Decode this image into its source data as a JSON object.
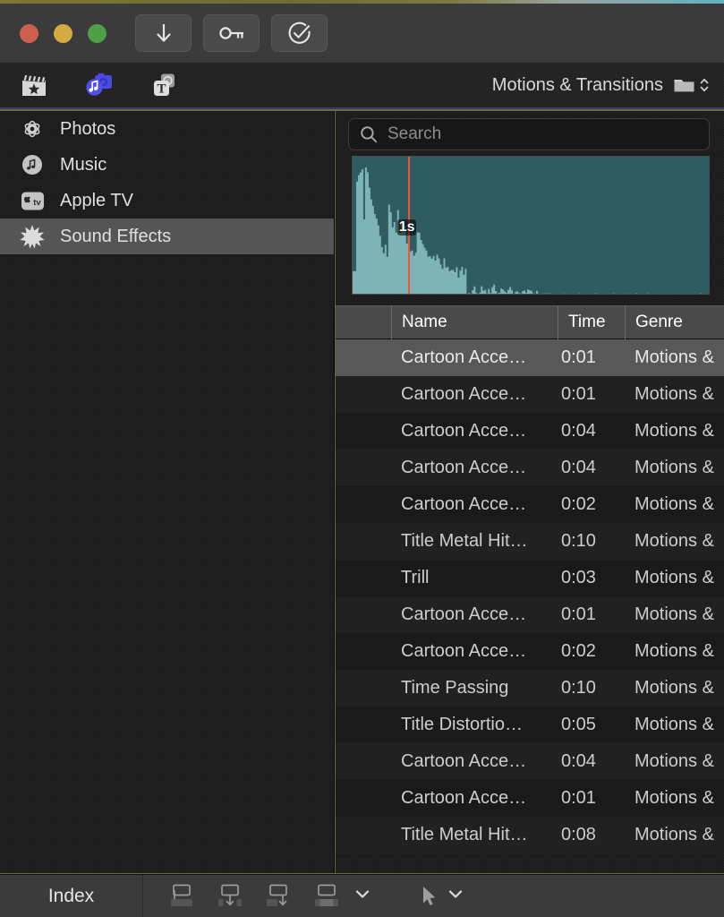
{
  "window": {
    "traffic_lights": [
      {
        "name": "close-button",
        "color": "#cc5f4f"
      },
      {
        "name": "minimize-button",
        "color": "#d5ab3f"
      },
      {
        "name": "zoom-button",
        "color": "#4f9e48"
      }
    ],
    "toolbar_buttons": [
      {
        "name": "download-button",
        "icon": "download-arrow-icon"
      },
      {
        "name": "keyword-button",
        "icon": "key-icon"
      },
      {
        "name": "share-approve-button",
        "icon": "checkmark-circle-icon"
      }
    ]
  },
  "browser_header": {
    "tabs": [
      {
        "name": "tab-libraries",
        "icon": "clapperboard-star-icon",
        "active": false
      },
      {
        "name": "tab-photos-audio",
        "icon": "photos-audio-icon",
        "active": true
      },
      {
        "name": "tab-titles-generators",
        "icon": "titles-generators-icon",
        "active": false
      }
    ],
    "title": "Motions & Transitions",
    "folder_icon": "folder-icon",
    "popup_icon": "chevron-up-down-icon"
  },
  "sidebar": {
    "items": [
      {
        "label": "Photos",
        "icon": "photos-flower-icon",
        "selected": false
      },
      {
        "label": "Music",
        "icon": "music-note-icon",
        "selected": false
      },
      {
        "label": "Apple TV",
        "icon": "apple-tv-icon",
        "selected": false
      },
      {
        "label": "Sound Effects",
        "icon": "sound-effects-star-icon",
        "selected": true
      }
    ]
  },
  "search": {
    "placeholder": "Search",
    "value": "",
    "icon": "search-icon"
  },
  "preview": {
    "playhead_label": "1s",
    "playhead_color": "#f0553a",
    "background_color": "#2f5c60",
    "wave_color": "#7fb4b6",
    "playhead_position_pct": 15.5
  },
  "table": {
    "columns": [
      "",
      "Name",
      "Time",
      "Genre"
    ],
    "rows": [
      {
        "name": "Cartoon Acce…",
        "time": "0:01",
        "genre": "Motions &",
        "selected": true
      },
      {
        "name": "Cartoon Acce…",
        "time": "0:01",
        "genre": "Motions &",
        "selected": false
      },
      {
        "name": "Cartoon Acce…",
        "time": "0:04",
        "genre": "Motions &",
        "selected": false
      },
      {
        "name": "Cartoon Acce…",
        "time": "0:04",
        "genre": "Motions &",
        "selected": false
      },
      {
        "name": "Cartoon Acce…",
        "time": "0:02",
        "genre": "Motions &",
        "selected": false
      },
      {
        "name": "Title Metal Hit…",
        "time": "0:10",
        "genre": "Motions &",
        "selected": false
      },
      {
        "name": "Trill",
        "time": "0:03",
        "genre": "Motions &",
        "selected": false
      },
      {
        "name": "Cartoon Acce…",
        "time": "0:01",
        "genre": "Motions &",
        "selected": false
      },
      {
        "name": "Cartoon Acce…",
        "time": "0:02",
        "genre": "Motions &",
        "selected": false
      },
      {
        "name": "Time Passing",
        "time": "0:10",
        "genre": "Motions &",
        "selected": false
      },
      {
        "name": "Title Distortio…",
        "time": "0:05",
        "genre": "Motions &",
        "selected": false
      },
      {
        "name": "Cartoon Acce…",
        "time": "0:04",
        "genre": "Motions &",
        "selected": false
      },
      {
        "name": "Cartoon Acce…",
        "time": "0:01",
        "genre": "Motions &",
        "selected": false
      },
      {
        "name": "Title Metal Hit…",
        "time": "0:08",
        "genre": "Motions &",
        "selected": false
      }
    ]
  },
  "bottom_bar": {
    "index_label": "Index",
    "tools": [
      {
        "name": "connect-clip-button",
        "icon": "connect-clip-icon"
      },
      {
        "name": "insert-clip-button",
        "icon": "insert-clip-icon"
      },
      {
        "name": "append-clip-button",
        "icon": "append-clip-icon"
      },
      {
        "name": "overwrite-clip-button",
        "icon": "overwrite-clip-icon"
      }
    ],
    "overwrite_chevron_icon": "chevron-down-icon",
    "select-tool": {
      "name": "select-tool-button",
      "icon": "arrow-cursor-icon",
      "chevron": "chevron-down-icon"
    }
  }
}
